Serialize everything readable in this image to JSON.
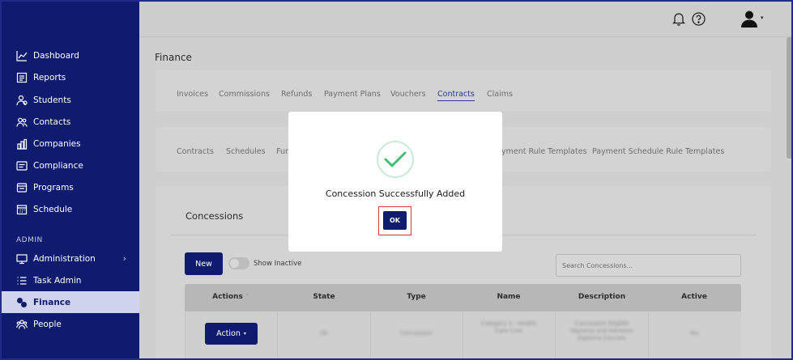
{
  "sidebar": {
    "items": [
      {
        "label": "Dashboard",
        "icon": "chart-line-icon"
      },
      {
        "label": "Reports",
        "icon": "report-icon"
      },
      {
        "label": "Students",
        "icon": "students-icon"
      },
      {
        "label": "Contacts",
        "icon": "contacts-icon"
      },
      {
        "label": "Companies",
        "icon": "companies-icon"
      },
      {
        "label": "Compliance",
        "icon": "compliance-icon"
      },
      {
        "label": "Programs",
        "icon": "programs-icon"
      },
      {
        "label": "Schedule",
        "icon": "calendar-icon"
      }
    ],
    "section_admin": "ADMIN",
    "admin_items": [
      {
        "label": "Administration",
        "icon": "monitor-icon"
      },
      {
        "label": "Task Admin",
        "icon": "list-icon"
      },
      {
        "label": "Finance",
        "icon": "finance-icon",
        "active": true
      },
      {
        "label": "People",
        "icon": "people-icon"
      }
    ],
    "chevron": "›"
  },
  "header": {
    "title": "Finance"
  },
  "tabs_primary": [
    "Invoices",
    "Commissions",
    "Refunds",
    "Payment Plans",
    "Vouchers",
    "Contracts",
    "Claims"
  ],
  "tabs_primary_active": "Contracts",
  "tabs_secondary": [
    "Contracts",
    "Schedules",
    "Fun",
    "yment Rule Templates",
    "Payment Schedule Rule Templates"
  ],
  "concessions": {
    "title": "Concessions",
    "new_label": "New",
    "show_inactive_label": "Show Inactive",
    "search_placeholder": "Search Concessions...",
    "columns": [
      "Actions",
      "State",
      "Type",
      "Name",
      "Description",
      "Active"
    ],
    "sort_indicator": "⌃",
    "row": {
      "action_label": "Action",
      "caret": "▾",
      "state": "Ok",
      "type": "Concession",
      "name": "Category 1 - Health Care Cost",
      "description": "Concession Eligible Diploma and Advance Diploma Courses",
      "active": "Yes"
    }
  },
  "modal": {
    "message": "Concession Successfully Added",
    "ok_label": "OK"
  },
  "colors": {
    "sidebar_bg": "#0f1b6e",
    "accent": "#2a3b8c",
    "success": "#3fbf73",
    "highlight": "#e0363f"
  }
}
